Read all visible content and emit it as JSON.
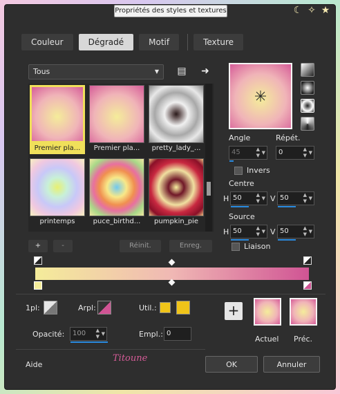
{
  "window": {
    "title": "Propriétés des styles et textures"
  },
  "titlebar_icons": [
    "moon-icon",
    "star-swirl-icon",
    "star-icon"
  ],
  "tabs": [
    {
      "label": "Couleur",
      "active": false
    },
    {
      "label": "Dégradé",
      "active": true
    },
    {
      "label": "Motif",
      "active": false
    },
    {
      "label": "Texture",
      "active": false
    }
  ],
  "gradient_list": {
    "filter_value": "Tous",
    "items": [
      {
        "label": "Premier pla...",
        "selected": true
      },
      {
        "label": "Premier pla...",
        "selected": false
      },
      {
        "label": "pretty_lady_...",
        "selected": false
      },
      {
        "label": "printemps",
        "selected": false
      },
      {
        "label": "puce_birthd...",
        "selected": false
      },
      {
        "label": "pumpkin_pie",
        "selected": false
      }
    ]
  },
  "list_buttons": {
    "add": "+",
    "remove": "-",
    "reset": "Réinit.",
    "save": "Enreg."
  },
  "settings": {
    "angle_label": "Angle",
    "angle_value": "45",
    "repeat_label": "Répét.",
    "repeat_value": "0",
    "invert_label": "Invers",
    "center_label": "Centre",
    "center_h": "50",
    "center_v": "50",
    "source_label": "Source",
    "source_h": "50",
    "source_v": "50",
    "link_label": "Liaison",
    "h_label": "H",
    "v_label": "V"
  },
  "stops": {
    "opacity_label": "Opacité:",
    "opacity_value": "100",
    "fg_label": "1pl:",
    "bg_label": "Arpl:",
    "user_label": "Util.:",
    "location_label": "Empl.:",
    "location_value": "0",
    "user_color": "#f0c419"
  },
  "current": {
    "label": "Actuel"
  },
  "previous": {
    "label": "Préc."
  },
  "footer": {
    "help": "Aide",
    "ok": "OK",
    "cancel": "Annuler",
    "signature": "Titoune"
  },
  "colors": {
    "accent": "#f0e05a",
    "pink": "#d05494",
    "yellow": "#f4ec9a"
  }
}
